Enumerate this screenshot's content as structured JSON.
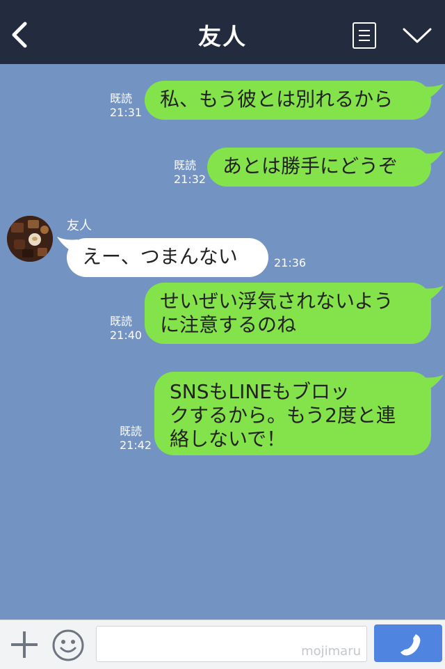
{
  "header": {
    "title": "友人"
  },
  "messages": [
    {
      "from": "me",
      "lines": [
        "私、もう彼とは別れるから"
      ],
      "read": "既読",
      "time": "21:31"
    },
    {
      "from": "me",
      "lines": [
        "あとは勝手にどうぞ"
      ],
      "read": "既読",
      "time": "21:32"
    },
    {
      "from": "them",
      "sender": "友人",
      "lines": [
        "えー、つまんない"
      ],
      "time": "21:36"
    },
    {
      "from": "me",
      "lines": [
        "せいぜい浮気されないよう",
        "に注意するのね"
      ],
      "read": "既読",
      "time": "21:40"
    },
    {
      "from": "me",
      "lines": [
        "SNSもLINEもブロッ",
        "クするから。もう2度と連",
        "絡しないで！"
      ],
      "read": "既読",
      "time": "21:42"
    }
  ],
  "footer": {
    "input_placeholder": "",
    "watermark": "mojimaru"
  },
  "colors": {
    "header": "#232b3e",
    "chat_bg": "#7393c2",
    "my_bubble": "#84e24a",
    "their_bubble": "#ffffff",
    "call_button": "#4f84e0"
  },
  "icons": [
    "back-arrow-icon",
    "menu-list-icon",
    "chevron-down-icon",
    "plus-icon",
    "emoji-icon",
    "phone-icon"
  ]
}
